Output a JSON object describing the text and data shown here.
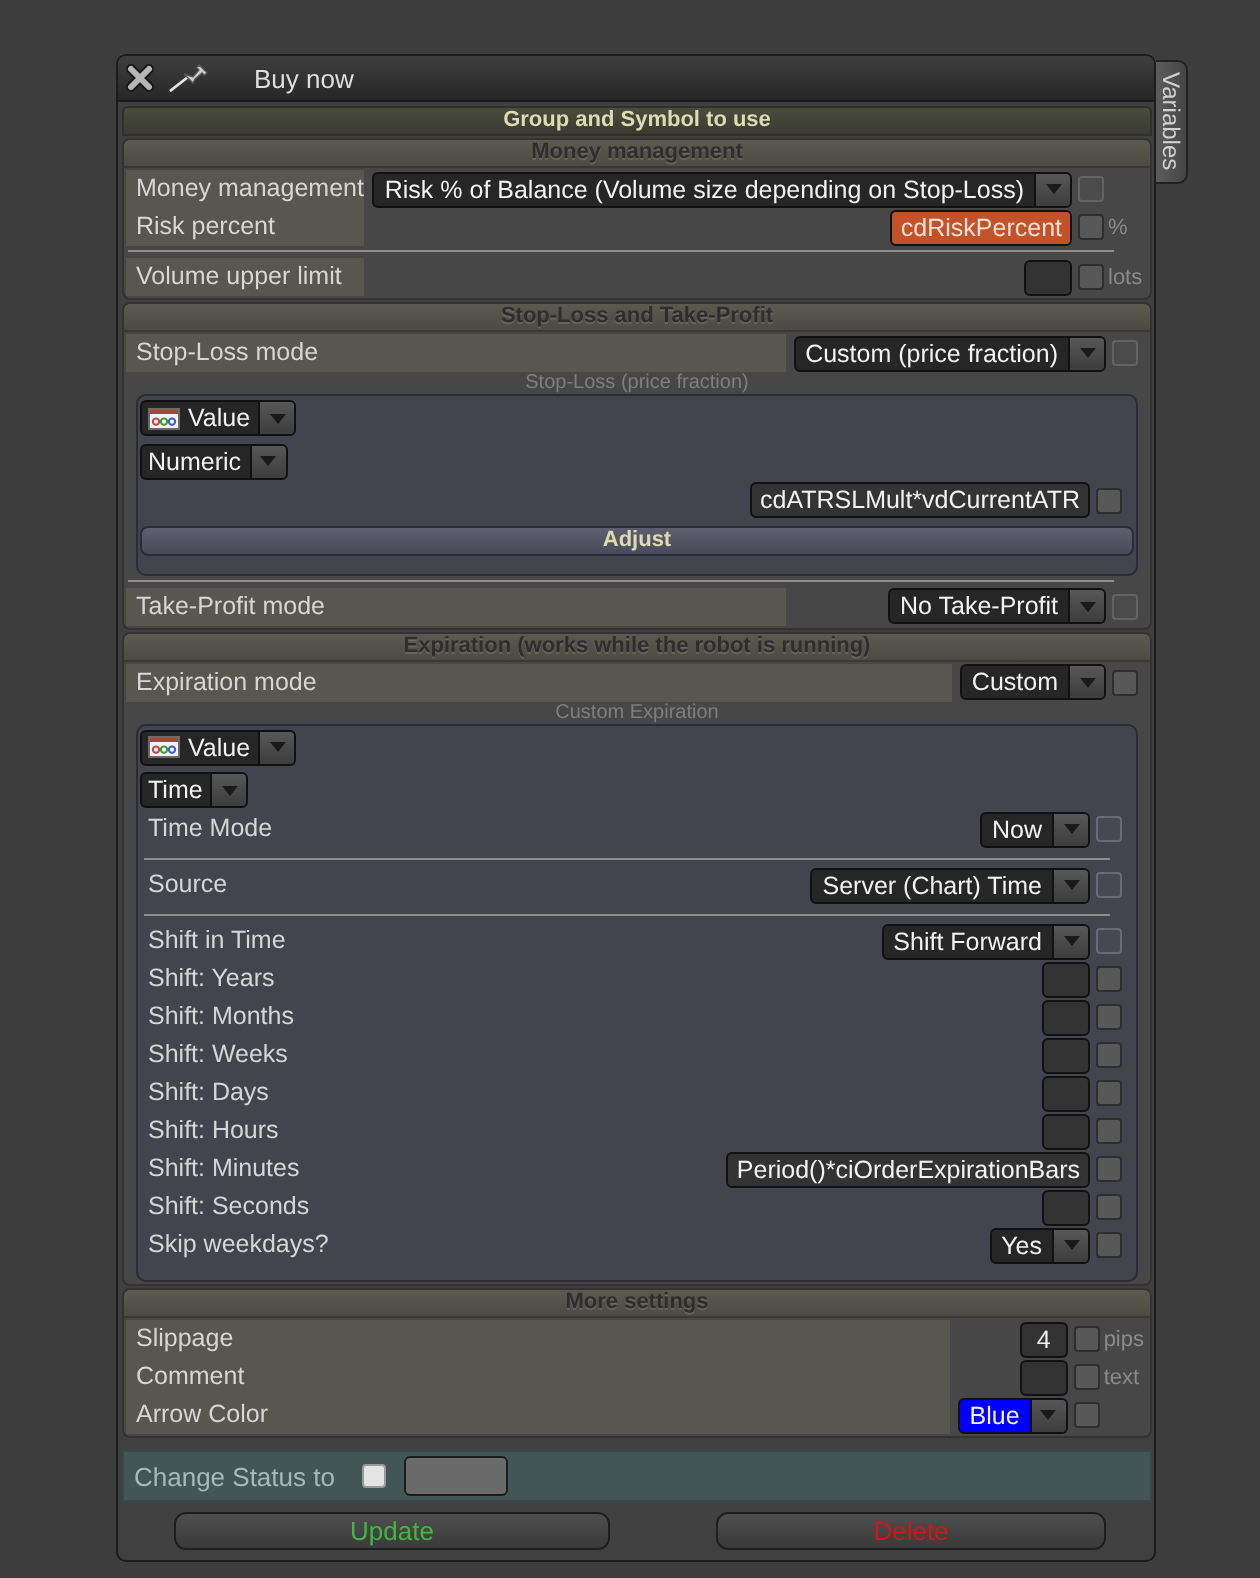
{
  "window": {
    "title": "Buy now",
    "side_tab": "Variables"
  },
  "group_header": "Group and Symbol to use",
  "sections": [
    {
      "title": "Money management",
      "items": [
        {
          "kind": "row",
          "label": "Money management",
          "control": {
            "kind": "dropdown",
            "value": "Risk % of Balance (Volume size depending on Stop-Loss)"
          },
          "checkbox": {
            "checked": false,
            "disabled": true
          }
        },
        {
          "kind": "row",
          "label": "Risk percent",
          "control": {
            "kind": "field",
            "value": "cdRiskPercent",
            "highlighted": true
          },
          "checkbox": {
            "checked": false,
            "disabled": false
          },
          "unit": "%"
        },
        {
          "kind": "divider"
        },
        {
          "kind": "row",
          "label": "Volume upper limit",
          "control": {
            "kind": "field",
            "highlighted": false
          },
          "checkbox": {
            "checked": false,
            "disabled": false
          },
          "unit": "lots"
        }
      ]
    },
    {
      "title": "Stop-Loss and Take-Profit",
      "items": [
        {
          "kind": "row",
          "label": "Stop-Loss mode",
          "control": {
            "kind": "dropdown",
            "value": "Custom (price fraction)"
          },
          "checkbox": {
            "checked": false,
            "disabled": true
          }
        },
        {
          "kind": "panel",
          "caption": "Stop-Loss (price fraction)",
          "items": [
            {
              "kind": "source_select",
              "value": "Value"
            },
            {
              "kind": "type_select",
              "value": "Numeric"
            },
            {
              "kind": "row",
              "control": {
                "kind": "field",
                "value": "cdATRSLMult*vdCurrentATR",
                "highlighted": false
              },
              "checkbox": {
                "checked": false,
                "disabled": false
              }
            },
            {
              "kind": "bar_button",
              "label": "Adjust"
            }
          ]
        },
        {
          "kind": "divider"
        },
        {
          "kind": "row",
          "label": "Take-Profit mode",
          "control": {
            "kind": "dropdown",
            "value": "No Take-Profit"
          },
          "checkbox": {
            "checked": false,
            "disabled": true
          }
        }
      ]
    },
    {
      "title": "Expiration (works while the robot is running)",
      "items": [
        {
          "kind": "row",
          "label": "Expiration mode",
          "control": {
            "kind": "dropdown",
            "value": "Custom"
          },
          "checkbox": {
            "checked": false,
            "disabled": false
          }
        },
        {
          "kind": "panel",
          "caption": "Custom Expiration",
          "items": [
            {
              "kind": "source_select",
              "value": "Value"
            },
            {
              "kind": "type_select",
              "value": "Time"
            },
            {
              "kind": "row",
              "label": "Time Mode",
              "control": {
                "kind": "dropdown",
                "value": "Now"
              },
              "checkbox": {
                "checked": false,
                "disabled": true
              }
            },
            {
              "kind": "divider"
            },
            {
              "kind": "row",
              "label": "Source",
              "control": {
                "kind": "dropdown",
                "value": "Server (Chart) Time"
              },
              "checkbox": {
                "checked": false,
                "disabled": true
              }
            },
            {
              "kind": "divider"
            },
            {
              "kind": "row",
              "label": "Shift in Time",
              "control": {
                "kind": "dropdown",
                "value": "Shift Forward"
              },
              "checkbox": {
                "checked": false,
                "disabled": true
              }
            },
            {
              "kind": "row",
              "label": "Shift: Years",
              "control": {
                "kind": "field",
                "highlighted": false
              },
              "checkbox": {
                "checked": false,
                "disabled": false
              }
            },
            {
              "kind": "row",
              "label": "Shift: Months",
              "control": {
                "kind": "field",
                "highlighted": false
              },
              "checkbox": {
                "checked": false,
                "disabled": false
              }
            },
            {
              "kind": "row",
              "label": "Shift: Weeks",
              "control": {
                "kind": "field",
                "highlighted": false
              },
              "checkbox": {
                "checked": false,
                "disabled": false
              }
            },
            {
              "kind": "row",
              "label": "Shift: Days",
              "control": {
                "kind": "field",
                "highlighted": false
              },
              "checkbox": {
                "checked": false,
                "disabled": false
              }
            },
            {
              "kind": "row",
              "label": "Shift: Hours",
              "control": {
                "kind": "field",
                "highlighted": false
              },
              "checkbox": {
                "checked": false,
                "disabled": false
              }
            },
            {
              "kind": "row",
              "label": "Shift: Minutes",
              "control": {
                "kind": "field",
                "value": "Period()*ciOrderExpirationBars",
                "highlighted": false
              },
              "checkbox": {
                "checked": false,
                "disabled": false
              }
            },
            {
              "kind": "row",
              "label": "Shift: Seconds",
              "control": {
                "kind": "field",
                "highlighted": false
              },
              "checkbox": {
                "checked": false,
                "disabled": false
              }
            },
            {
              "kind": "row",
              "label": "Skip weekdays?",
              "control": {
                "kind": "dropdown",
                "value": "Yes"
              },
              "checkbox": {
                "checked": false,
                "disabled": false
              }
            }
          ]
        }
      ]
    },
    {
      "title": "More settings",
      "items": [
        {
          "kind": "row",
          "label": "Slippage",
          "control": {
            "kind": "field",
            "value": "4",
            "highlighted": false
          },
          "checkbox": {
            "checked": false,
            "disabled": false
          },
          "unit": "pips"
        },
        {
          "kind": "row",
          "label": "Comment",
          "control": {
            "kind": "field",
            "highlighted": false
          },
          "checkbox": {
            "checked": false,
            "disabled": false
          },
          "unit": "text"
        },
        {
          "kind": "row",
          "label": "Arrow Color",
          "control": {
            "kind": "dropdown",
            "value": "Blue",
            "color": "#0000ff"
          },
          "checkbox": {
            "checked": false,
            "disabled": false
          }
        }
      ]
    }
  ],
  "status": {
    "label": "Change Status to",
    "checked": false
  },
  "buttons": [
    {
      "label": "Update",
      "kind": "confirm"
    },
    {
      "label": "Delete",
      "kind": "danger"
    }
  ]
}
